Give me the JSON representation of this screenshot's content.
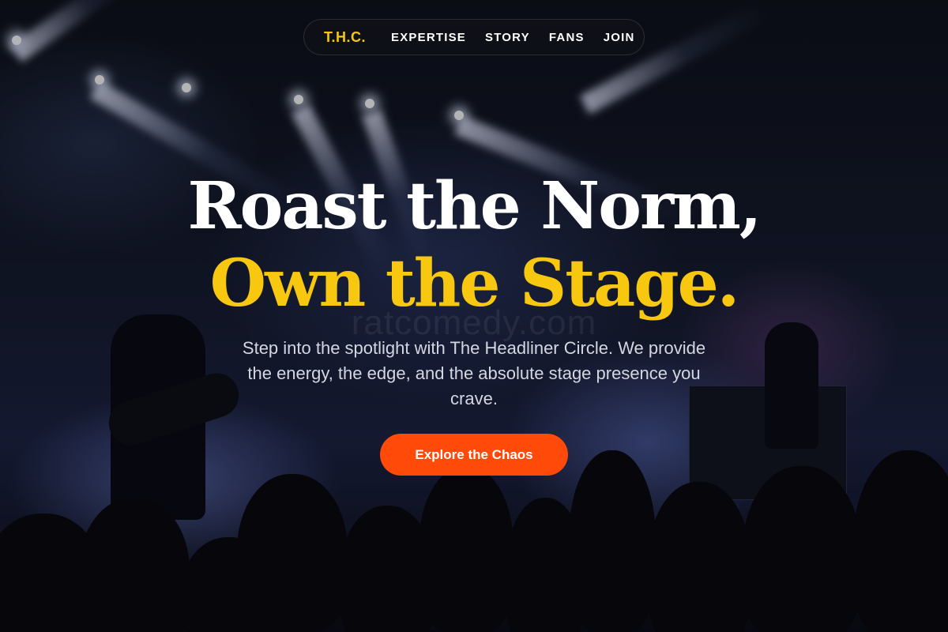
{
  "nav": {
    "logo": "T.H.C.",
    "links": [
      {
        "label": "EXPERTISE"
      },
      {
        "label": "STORY"
      },
      {
        "label": "FANS"
      },
      {
        "label": "JOIN"
      }
    ]
  },
  "hero": {
    "headline_line1": "Roast the Norm,",
    "headline_line2": "Own the Stage.",
    "subtitle": "Step into the spotlight with The Headliner Circle. We provide the energy, the edge, and the absolute stage presence you crave.",
    "cta_label": "Explore the Chaos",
    "watermark": "ratcomedy.com"
  },
  "colors": {
    "accent_yellow": "#f7c80f",
    "cta_orange": "#ff4a0a",
    "background": "#07090f"
  }
}
